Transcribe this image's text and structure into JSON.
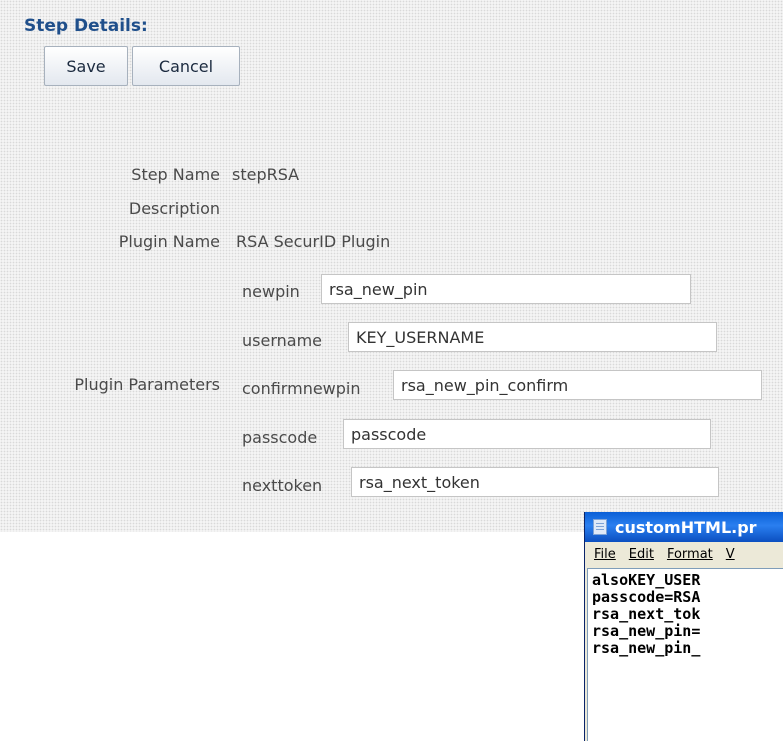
{
  "step_details": {
    "title": "Step Details:",
    "save_label": "Save",
    "cancel_label": "Cancel",
    "step_name_label": "Step Name",
    "step_name_value": "stepRSA",
    "description_label": "Description",
    "plugin_name_label": "Plugin Name",
    "plugin_name_value": "RSA SecurID Plugin",
    "plugin_parameters_label": "Plugin Parameters",
    "params": [
      {
        "name": "newpin",
        "value": "rsa_new_pin"
      },
      {
        "name": "username",
        "value": "KEY_USERNAME"
      },
      {
        "name": "confirmnewpin",
        "value": "rsa_new_pin_confirm"
      },
      {
        "name": "passcode",
        "value": "passcode"
      },
      {
        "name": "nexttoken",
        "value": "rsa_next_token"
      }
    ]
  },
  "notepad": {
    "title": "customHTML.pr",
    "menu": [
      "File",
      "Edit",
      "Format",
      "V"
    ],
    "lines": [
      "alsoKEY_USER",
      "passcode=RSA",
      "rsa_next_tok",
      "rsa_new_pin=",
      "rsa_new_pin_"
    ]
  }
}
